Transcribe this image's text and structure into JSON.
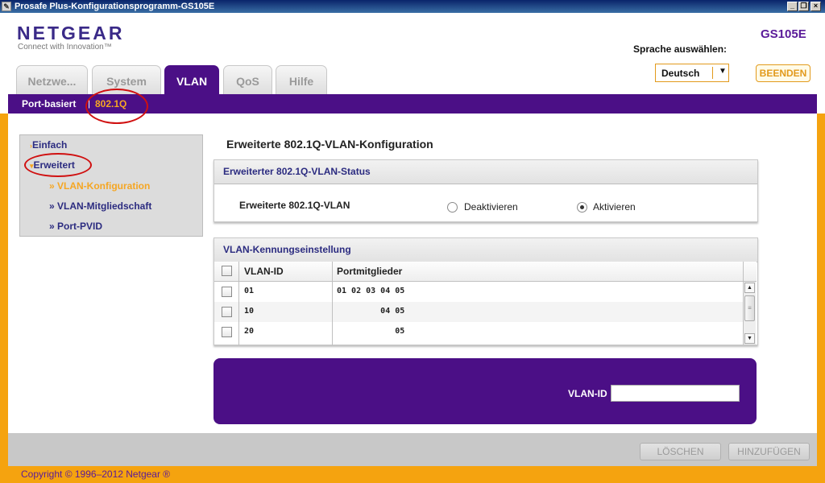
{
  "window": {
    "title": "Prosafe Plus-Konfigurationsprogramm-GS105E"
  },
  "header": {
    "logo": "NETGEAR",
    "tagline": "Connect with Innovation™",
    "model": "GS105E",
    "language_label": "Sprache auswählen:",
    "language_value": "Deutsch",
    "logout_label": "BEENDEN"
  },
  "tabs": [
    {
      "label": "Netzwe..."
    },
    {
      "label": "System"
    },
    {
      "label": "VLAN"
    },
    {
      "label": "QoS"
    },
    {
      "label": "Hilfe"
    }
  ],
  "subnav": {
    "port_based": "Port-basiert",
    "separator": "|",
    "dot1q": "802.1Q"
  },
  "sidebar": {
    "items": [
      {
        "label": "Einfach"
      },
      {
        "label": "Erweitert"
      }
    ],
    "subitems": [
      {
        "label": "» VLAN-Konfiguration"
      },
      {
        "label": "» VLAN-Mitgliedschaft"
      },
      {
        "label": "» Port-PVID"
      }
    ]
  },
  "main": {
    "title": "Erweiterte 802.1Q-VLAN-Konfiguration",
    "status_panel": {
      "heading": "Erweiterter 802.1Q-VLAN-Status",
      "row_label": "Erweiterte 802.1Q-VLAN",
      "option_off": "Deaktivieren",
      "option_on": "Aktivieren",
      "selected": "Aktivieren"
    },
    "vlan_panel": {
      "heading": "VLAN-Kennungseinstellung",
      "columns": [
        "VLAN-ID",
        "Portmitglieder"
      ],
      "rows": [
        {
          "id": "01",
          "ports": "01 02 03 04 05"
        },
        {
          "id": "10",
          "ports": "         04 05"
        },
        {
          "id": "20",
          "ports": "            05"
        }
      ]
    },
    "entry": {
      "label": "VLAN-ID",
      "value": ""
    }
  },
  "footer": {
    "delete_label": "LÖSCHEN",
    "add_label": "HINZUFÜGEN",
    "copyright": "Copyright © 1996–2012 Netgear ®"
  },
  "colors": {
    "brand_purple": "#4b0f86",
    "accent_orange": "#f5a30f",
    "annotation_red": "#d01010"
  }
}
